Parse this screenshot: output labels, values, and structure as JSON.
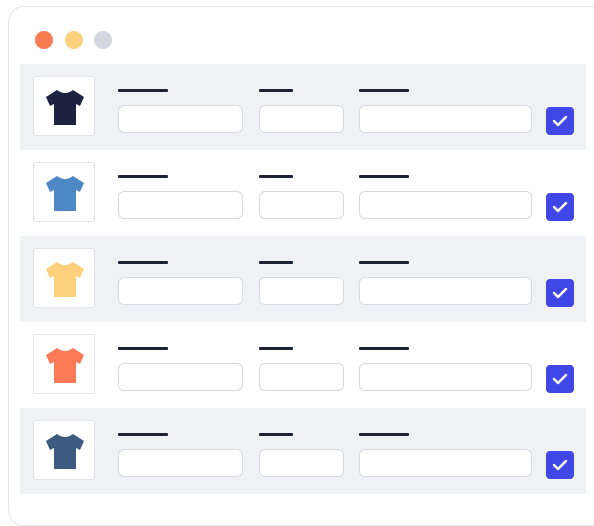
{
  "window_controls": {
    "close_color": "#f77b53",
    "minimize_color": "#fdd07e",
    "maximize_color": "#d4d7e0"
  },
  "accent_color": "#3f47e6",
  "products": [
    {
      "shirt_color": "#1c2240",
      "icon": "tshirt-icon",
      "name": "",
      "size": "",
      "description": "",
      "selected": true
    },
    {
      "shirt_color": "#4d88c4",
      "icon": "tshirt-icon",
      "name": "",
      "size": "",
      "description": "",
      "selected": true
    },
    {
      "shirt_color": "#fdd07e",
      "icon": "tshirt-icon",
      "name": "",
      "size": "",
      "description": "",
      "selected": true
    },
    {
      "shirt_color": "#fb7b56",
      "icon": "tshirt-icon",
      "name": "",
      "size": "",
      "description": "",
      "selected": true
    },
    {
      "shirt_color": "#3d5a80",
      "icon": "tshirt-icon",
      "name": "",
      "size": "",
      "description": "",
      "selected": true
    }
  ]
}
